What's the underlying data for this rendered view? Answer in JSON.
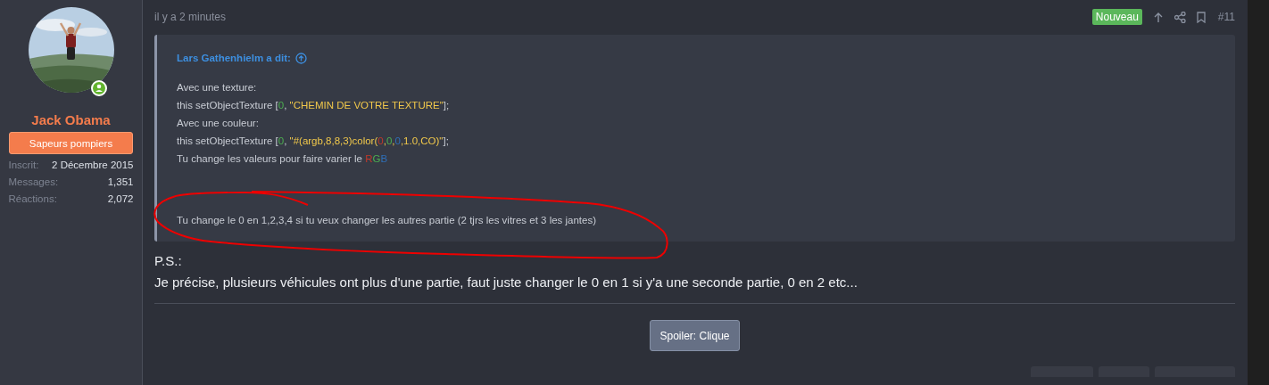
{
  "user": {
    "name": "Jack Obama",
    "banner": "Sapeurs pompiers",
    "online": true,
    "stats": [
      {
        "label": "Inscrit:",
        "value": "2 Décembre 2015"
      },
      {
        "label": "Messages:",
        "value": "1,351"
      },
      {
        "label": "Réactions:",
        "value": "2,072"
      }
    ]
  },
  "post": {
    "time": "il y a 2 minutes",
    "badge": "Nouveau",
    "number": "#11",
    "quote": {
      "author": "Lars Gathenhielm a dit:",
      "lines": [
        [
          {
            "kind": "plain",
            "text": "Avec une texture:"
          }
        ],
        [
          {
            "kind": "plain",
            "text": "this setObjectTexture ["
          },
          {
            "kind": "green",
            "text": "0"
          },
          {
            "kind": "plain",
            "text": ", "
          },
          {
            "kind": "string",
            "text": "\"CHEMIN DE VOTRE TEXTURE\""
          },
          {
            "kind": "plain",
            "text": "];"
          }
        ],
        [
          {
            "kind": "plain",
            "text": "Avec une couleur:"
          }
        ],
        [
          {
            "kind": "plain",
            "text": "this setObjectTexture ["
          },
          {
            "kind": "green",
            "text": "0"
          },
          {
            "kind": "plain",
            "text": ", "
          },
          {
            "kind": "string",
            "text": "\"#(argb,8,8,3)color("
          },
          {
            "kind": "red",
            "text": "0"
          },
          {
            "kind": "string",
            "text": ","
          },
          {
            "kind": "green",
            "text": "0"
          },
          {
            "kind": "string",
            "text": ","
          },
          {
            "kind": "blue",
            "text": "0"
          },
          {
            "kind": "string",
            "text": ",1.0,CO)\""
          },
          {
            "kind": "plain",
            "text": "];"
          }
        ],
        [
          {
            "kind": "plain",
            "text": "Tu change les valeurs pour faire varier le "
          },
          {
            "kind": "red",
            "text": "R"
          },
          {
            "kind": "green",
            "text": "G"
          },
          {
            "kind": "blue",
            "text": "B"
          }
        ]
      ],
      "note": "Tu change le 0 en 1,2,3,4 si tu veux changer les autres partie (2 tjrs les vitres et 3 les jantes)"
    },
    "paragraphs": [
      "P.S.:",
      "Je précise, plusieurs véhicules ont plus d'une partie, faut juste changer le 0 en 1 si y'a une seconde partie, 0 en 2 etc..."
    ],
    "spoiler": "Spoiler: Clique"
  }
}
